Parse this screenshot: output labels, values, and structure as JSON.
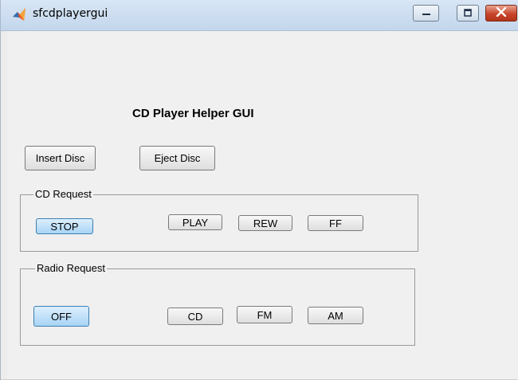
{
  "window": {
    "title": "sfcdplayergui",
    "icon": "matlab-membrane-icon",
    "controls": [
      "minimize-icon",
      "maximize-icon",
      "close-icon"
    ]
  },
  "gui": {
    "title": "CD Player Helper GUI",
    "insert_label": "Insert Disc",
    "eject_label": "Eject Disc"
  },
  "cd_request": {
    "label": "CD Request",
    "buttons": [
      "STOP",
      "PLAY",
      "REW",
      "FF"
    ],
    "active": "STOP"
  },
  "radio_request": {
    "label": "Radio Request",
    "buttons": [
      "OFF",
      "CD",
      "FM",
      "AM"
    ],
    "active": "OFF"
  },
  "colors": {
    "titlebar": "#c9dbef",
    "client_background": "#f0f0f0",
    "active_button": "#a9d4f5",
    "close_button": "#c8452c"
  }
}
